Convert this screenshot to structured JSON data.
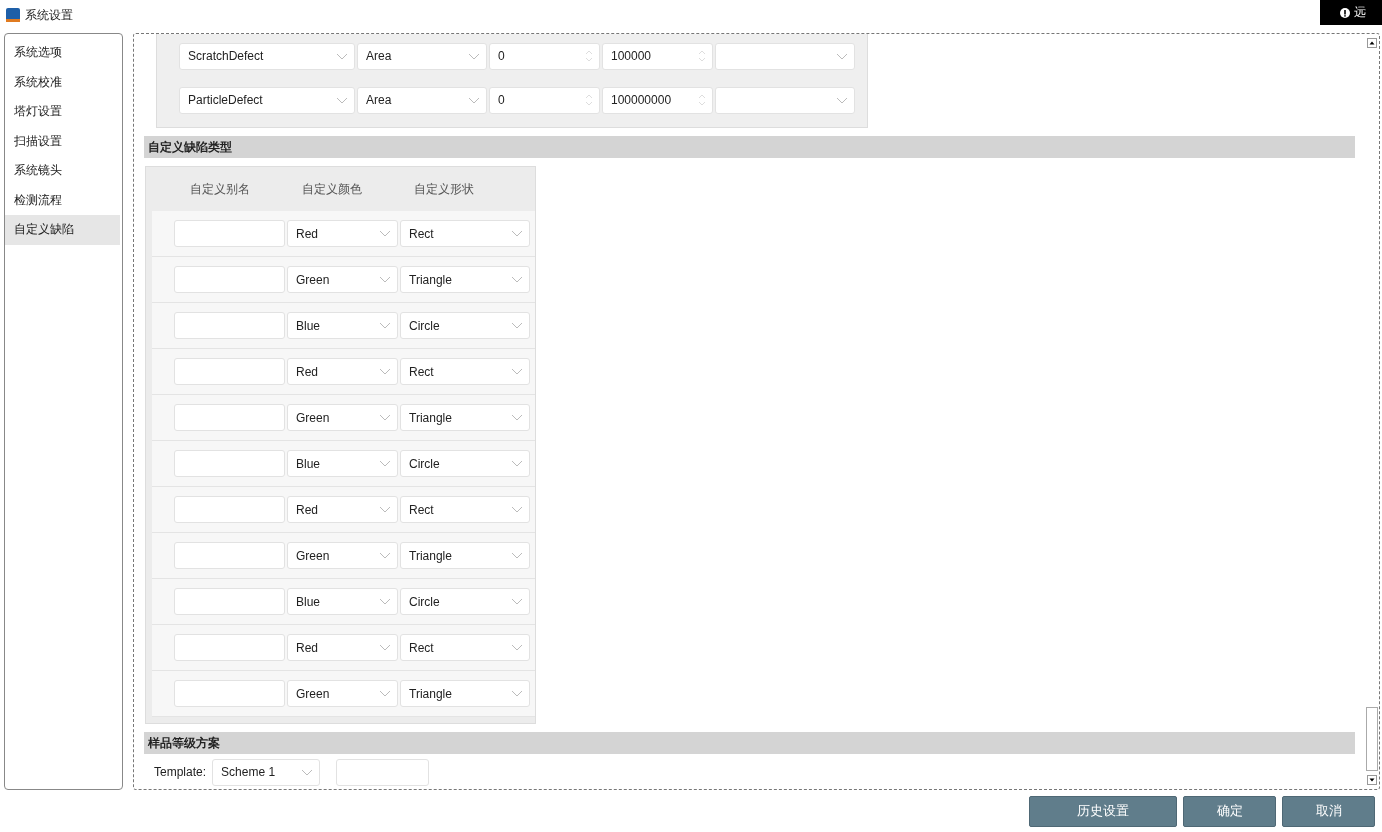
{
  "window": {
    "title": "系统设置"
  },
  "remote_badge": {
    "label": "远"
  },
  "sidebar": {
    "items": [
      {
        "label": "系统选项",
        "selected": false
      },
      {
        "label": "系统校准",
        "selected": false
      },
      {
        "label": "塔灯设置",
        "selected": false
      },
      {
        "label": "扫描设置",
        "selected": false
      },
      {
        "label": "系统镜头",
        "selected": false
      },
      {
        "label": "检测流程",
        "selected": false
      },
      {
        "label": "自定义缺陷",
        "selected": true
      }
    ]
  },
  "defect_filters": {
    "rows": [
      {
        "defect": "ScratchDefect",
        "feature": "Area",
        "min": "0",
        "max": "100000"
      },
      {
        "defect": "ParticleDefect",
        "feature": "Area",
        "min": "0",
        "max": "100000000"
      }
    ]
  },
  "custom_defects": {
    "title": "自定义缺陷类型",
    "columns": [
      "自定义别名",
      "自定义颜色",
      "自定义形状"
    ],
    "rows": [
      {
        "color_option": "Red",
        "shape": "Rect"
      },
      {
        "color_option": "Green",
        "shape": "Triangle"
      },
      {
        "color_option": "Blue",
        "shape": "Circle"
      },
      {
        "color_option": "Red",
        "shape": "Rect"
      },
      {
        "color_option": "Green",
        "shape": "Triangle"
      },
      {
        "color_option": "Blue",
        "shape": "Circle"
      },
      {
        "color_option": "Red",
        "shape": "Rect"
      },
      {
        "color_option": "Green",
        "shape": "Triangle"
      },
      {
        "color_option": "Blue",
        "shape": "Circle"
      },
      {
        "color_option": "Red",
        "shape": "Rect"
      },
      {
        "color_option": "Green",
        "shape": "Triangle"
      }
    ]
  },
  "grade_scheme": {
    "title": "样品等级方案",
    "template_label": "Template:",
    "template": "Scheme 1"
  },
  "buttons": [
    "历史设置",
    "确定",
    "取消"
  ]
}
